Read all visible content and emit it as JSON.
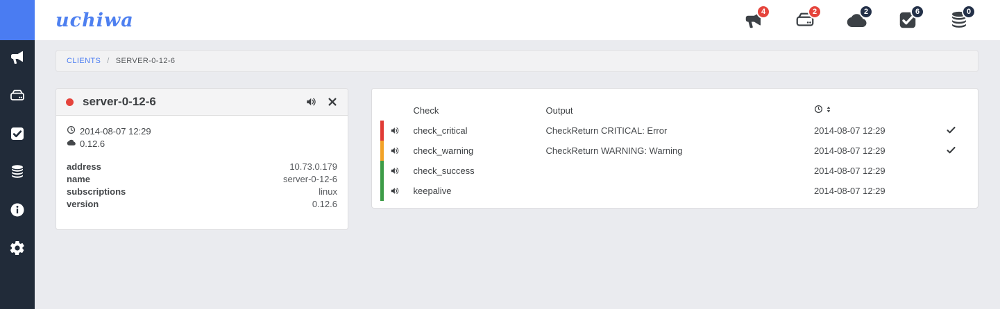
{
  "brand": {
    "logo_text": "uchiwa"
  },
  "colors": {
    "accent_blue": "#4a7cf2",
    "sidebar_bg": "#212b39",
    "badge_red": "#e5443c",
    "badge_navy": "#233048",
    "critical": "#e03b35",
    "warning": "#f2a227",
    "success": "#3d9c47"
  },
  "icons": [
    "bullhorn-icon",
    "harddrive-icon",
    "cloud-icon",
    "check-square-icon",
    "database-icon",
    "info-icon",
    "gear-icon",
    "clock-icon",
    "volume-icon",
    "close-icon",
    "checkmark-icon",
    "sort-icon"
  ],
  "header": {
    "notifications": [
      {
        "name": "events",
        "count": "4"
      },
      {
        "name": "clients",
        "count": "2"
      },
      {
        "name": "aggregates",
        "count": "2"
      },
      {
        "name": "checks",
        "count": "6"
      },
      {
        "name": "stashes",
        "count": "0"
      }
    ]
  },
  "breadcrumb": {
    "link": "CLIENTS",
    "separator": "/",
    "current": "SERVER-0-12-6"
  },
  "client_card": {
    "title": "server-0-12-6",
    "timestamp": "2014-08-07 12:29",
    "agent_version": "0.12.6",
    "properties": [
      {
        "label": "address",
        "value": "10.73.0.179"
      },
      {
        "label": "name",
        "value": "server-0-12-6"
      },
      {
        "label": "subscriptions",
        "value": "linux"
      },
      {
        "label": "version",
        "value": "0.12.6"
      }
    ]
  },
  "checks_table": {
    "headers": {
      "check": "Check",
      "output": "Output"
    },
    "rows": [
      {
        "name": "check_critical",
        "output": "CheckReturn CRITICAL: Error",
        "time": "2014-08-07 12:29",
        "status": "critical",
        "resolved": true
      },
      {
        "name": "check_warning",
        "output": "CheckReturn WARNING: Warning",
        "time": "2014-08-07 12:29",
        "status": "warning",
        "resolved": true
      },
      {
        "name": "check_success",
        "output": "",
        "time": "2014-08-07 12:29",
        "status": "success",
        "resolved": false
      },
      {
        "name": "keepalive",
        "output": "",
        "time": "2014-08-07 12:29",
        "status": "success",
        "resolved": false
      }
    ]
  }
}
